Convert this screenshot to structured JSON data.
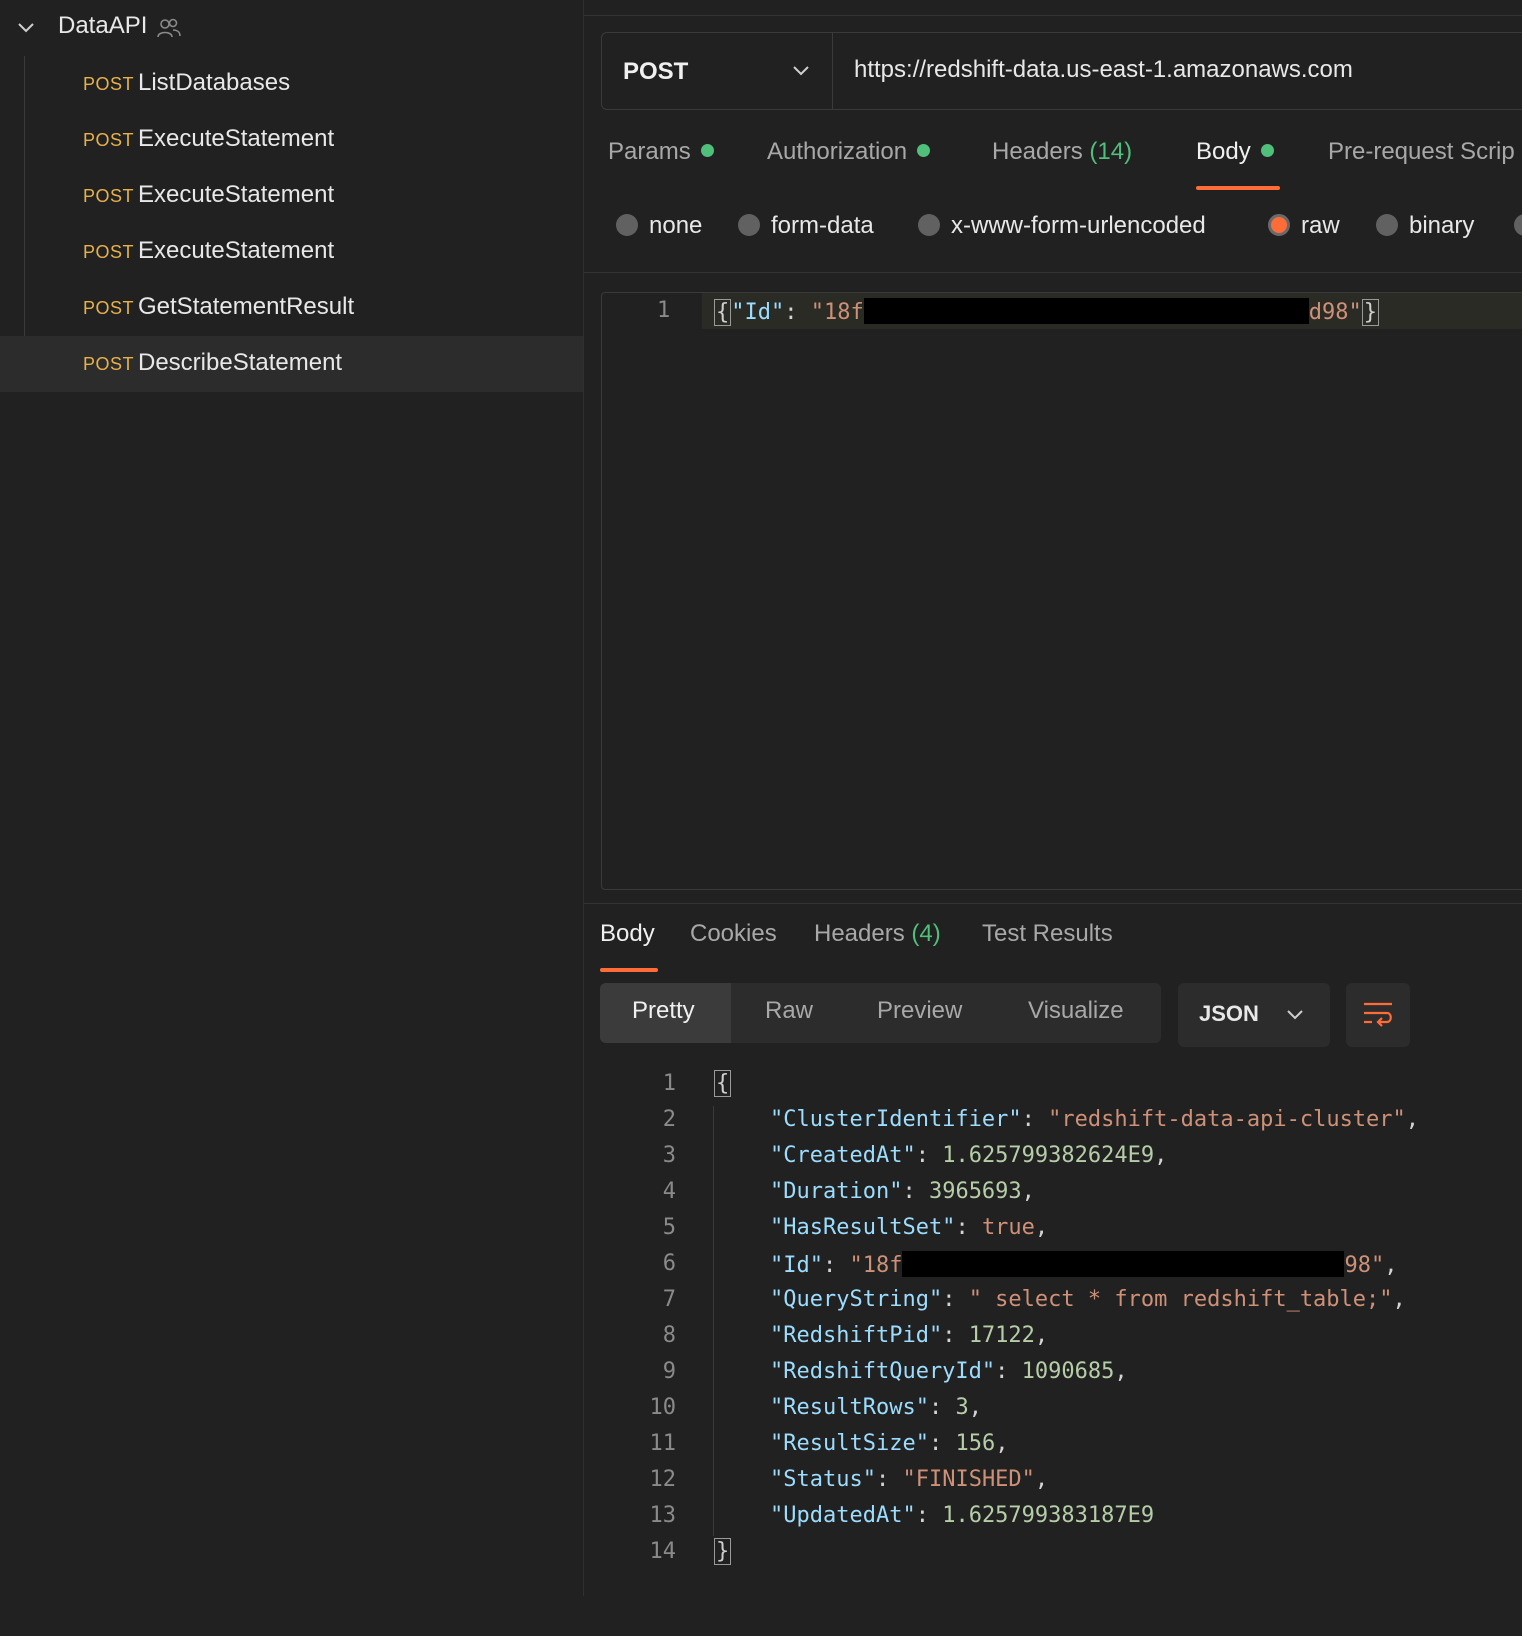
{
  "sidebar": {
    "collection": "DataAPI",
    "requests": [
      {
        "method": "POST",
        "name": "ListDatabases"
      },
      {
        "method": "POST",
        "name": "ExecuteStatement"
      },
      {
        "method": "POST",
        "name": "ExecuteStatement"
      },
      {
        "method": "POST",
        "name": "ExecuteStatement"
      },
      {
        "method": "POST",
        "name": "GetStatementResult"
      },
      {
        "method": "POST",
        "name": "DescribeStatement"
      }
    ]
  },
  "request": {
    "method": "POST",
    "url": "https://redshift-data.us-east-1.amazonaws.com",
    "tabs": {
      "params": "Params",
      "authorization": "Authorization",
      "headers": "Headers",
      "headers_count": "(14)",
      "body": "Body",
      "prerequest": "Pre-request Scrip"
    },
    "body_types": {
      "none": "none",
      "form_data": "form-data",
      "urlencoded": "x-www-form-urlencoded",
      "raw": "raw",
      "binary": "binary"
    },
    "editor": {
      "line_number": "1",
      "open_brace": "{",
      "key": "\"Id\"",
      "colon": ": ",
      "value_start": "\"18f",
      "value_end": "d98\"",
      "close_brace": "}"
    }
  },
  "response": {
    "tabs": {
      "body": "Body",
      "cookies": "Cookies",
      "headers": "Headers",
      "headers_count": "(4)",
      "tests": "Test Results"
    },
    "views": {
      "pretty": "Pretty",
      "raw": "Raw",
      "preview": "Preview",
      "visualize": "Visualize"
    },
    "format": "JSON",
    "lines": {
      "l1": {
        "n": "1",
        "t": "{"
      },
      "l2": {
        "n": "2",
        "k": "\"ClusterIdentifier\"",
        "v": "\"redshift-data-api-cluster\"",
        "e": ","
      },
      "l3": {
        "n": "3",
        "k": "\"CreatedAt\"",
        "v": "1.625799382624E9",
        "e": ","
      },
      "l4": {
        "n": "4",
        "k": "\"Duration\"",
        "v": "3965693",
        "e": ","
      },
      "l5": {
        "n": "5",
        "k": "\"HasResultSet\"",
        "v": "true",
        "e": ","
      },
      "l6": {
        "n": "6",
        "k": "\"Id\"",
        "v1": "\"18f",
        "v2": "98\"",
        "e": ","
      },
      "l7": {
        "n": "7",
        "k": "\"QueryString\"",
        "v": "\" select * from redshift_table;\"",
        "e": ","
      },
      "l8": {
        "n": "8",
        "k": "\"RedshiftPid\"",
        "v": "17122",
        "e": ","
      },
      "l9": {
        "n": "9",
        "k": "\"RedshiftQueryId\"",
        "v": "1090685",
        "e": ","
      },
      "l10": {
        "n": "10",
        "k": "\"ResultRows\"",
        "v": "3",
        "e": ","
      },
      "l11": {
        "n": "11",
        "k": "\"ResultSize\"",
        "v": "156",
        "e": ","
      },
      "l12": {
        "n": "12",
        "k": "\"Status\"",
        "v": "\"FINISHED\"",
        "e": ","
      },
      "l13": {
        "n": "13",
        "k": "\"UpdatedAt\"",
        "v": "1.625799383187E9",
        "e": ""
      },
      "l14": {
        "n": "14",
        "t": "}"
      }
    }
  },
  "colors": {
    "accent": "#ff6c37",
    "method_post": "#e8b14a",
    "status_dot": "#4fbf7a"
  }
}
